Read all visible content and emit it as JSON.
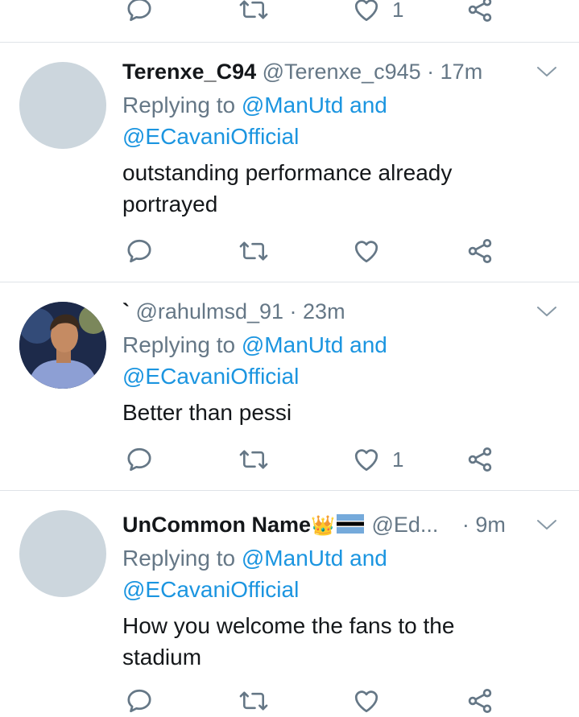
{
  "top_actions": {
    "like_count": "1"
  },
  "tweets": [
    {
      "name": "Terenxe_C94",
      "handle": "@Terenxe_c945",
      "time": "· 17m",
      "replying_prefix": "Replying to",
      "mention1": "@ManUtd",
      "and": "and",
      "mention2": "@ECavaniOfficial",
      "text_line1": "outstanding performance already",
      "text_line2": "portrayed",
      "like_count": ""
    },
    {
      "name": "`",
      "handle": "@rahulmsd_91",
      "time": "· 23m",
      "replying_prefix": "Replying to",
      "mention1": "@ManUtd",
      "and": "and",
      "mention2": "@ECavaniOfficial",
      "text_line1": "Better than pessi",
      "like_count": "1"
    },
    {
      "name": "UnCommon Name",
      "handle": "@Ed...",
      "time": "· 9m",
      "replying_prefix": "Replying to",
      "mention1": "@ManUtd",
      "and": "and",
      "mention2": "@ECavaniOfficial",
      "text_line1": "How you welcome the fans to the",
      "text_line2": "stadium"
    }
  ],
  "colors": {
    "text": "#14171a",
    "secondary": "#657786",
    "link": "#1b95e0",
    "divider": "#dfe3e8"
  }
}
